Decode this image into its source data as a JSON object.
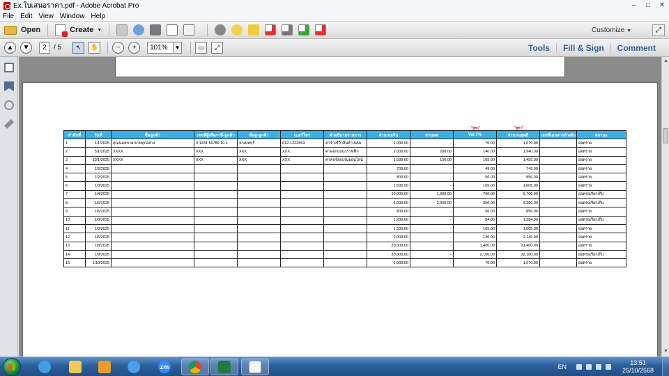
{
  "window": {
    "title": "Ex.ใบเสนอราคา.pdf - Adobe Acrobat Pro",
    "controls": [
      "–",
      "□",
      "✕"
    ]
  },
  "menu": [
    "File",
    "Edit",
    "View",
    "Window",
    "Help"
  ],
  "toolbar": {
    "open_label": "Open",
    "create_label": "Create",
    "create_arrow": "▼",
    "customize_label": "Customize",
    "customize_arrow": "▼",
    "expand_symbol": "⤢"
  },
  "nav": {
    "current_page": "2",
    "total_pages": "/ 5",
    "zoom": "101%",
    "zoom_arrow": "▼",
    "prev_symbol": "▲",
    "next_symbol": "▼",
    "zoom_out_symbol": "−",
    "zoom_in_symbol": "+",
    "links": [
      "Tools",
      "Fill & Sign",
      "Comment"
    ]
  },
  "document": {
    "notes": [
      "*สูตร*",
      "*สูตร*"
    ],
    "headers": [
      "ลำดับที่",
      "วันที่",
      "ชื่อลูกค้า",
      "เลขที่ผู้เสียภาษี-ลูกค้า",
      "ที่อยู่-ลูกค้า",
      "เบอร์โทร",
      "คำอธิบายรายการ",
      "จำนวนเงิน",
      "ส่วนลด",
      "Vat 7%",
      "จำนวนสุทธิ",
      "เลขที่เอกสารอ้างอิง",
      "สถานะ"
    ],
    "rows": [
      [
        "1",
        "1/1/2025",
        "คุณนอลขาย  ขายทุกอย่าง",
        "0 1234 56789 10 1",
        "จ.นนทบุรี",
        "012-1222553",
        "ค่าจ้างรีวิวสินค้า AAA",
        "1,000.00",
        "-",
        "70.00",
        "1,070.00",
        "",
        "ออตราย"
      ],
      [
        "2",
        "5/1/2025",
        "XXXX",
        "XXX",
        "XXX",
        "XXX",
        "ค่าออกแบบกราฟฟิก",
        "2,000.00",
        "200.00",
        "140.00",
        "1,940.00",
        "",
        "ออตราย"
      ],
      [
        "3",
        "10/1/2025",
        "XXXX",
        "XXX",
        "XXX",
        "XXX",
        "ค่าคอร์สอบรมออนไลน์",
        "1,500.00",
        "150.00",
        "105.00",
        "1,455.00",
        "",
        "ออตราย"
      ],
      [
        "4",
        "1/2/2025",
        "",
        "",
        "",
        "",
        "",
        "700.00",
        "-",
        "49.00",
        "749.00",
        "",
        "ออตราย"
      ],
      [
        "5",
        "1/2/2025",
        "",
        "",
        "",
        "",
        "",
        "800.00",
        "-",
        "56.00",
        "856.00",
        "",
        "ออตราย"
      ],
      [
        "6",
        "1/3/2025",
        "",
        "",
        "",
        "",
        "",
        "1,500.00",
        "-",
        "105.00",
        "1,605.00",
        "",
        "ออตราย"
      ],
      [
        "7",
        "1/4/2025",
        "",
        "",
        "",
        "",
        "",
        "10,000.00",
        "1,000.00",
        "700.00",
        "9,700.00",
        "",
        "ออตรอเรียกเก็บ"
      ],
      [
        "8",
        "1/5/2025",
        "",
        "",
        "",
        "",
        "",
        "5,000.00",
        "2,000.00",
        "350.00",
        "3,350.00",
        "",
        "ออตรอเรียกเก็บ"
      ],
      [
        "9",
        "1/6/2025",
        "",
        "",
        "",
        "",
        "",
        "800.00",
        "-",
        "56.00",
        "856.00",
        "",
        "ออตราย"
      ],
      [
        "10",
        "1/8/2025",
        "",
        "",
        "",
        "",
        "",
        "1,200.00",
        "-",
        "84.00",
        "1,284.00",
        "",
        "ออตรอเรียกเก็บ"
      ],
      [
        "11",
        "1/9/2025",
        "",
        "",
        "",
        "",
        "",
        "1,500.00",
        "-",
        "105.00",
        "1,605.00",
        "",
        "ออตราย"
      ],
      [
        "12",
        "1/6/2025",
        "",
        "",
        "",
        "",
        "",
        "2,000.00",
        "-",
        "140.00",
        "2,140.00",
        "",
        "ออตราย"
      ],
      [
        "13",
        "1/8/2025",
        "",
        "",
        "",
        "",
        "",
        "20,000.00",
        "-",
        "1,400.00",
        "21,400.00",
        "",
        "ออตราย"
      ],
      [
        "14",
        "1/9/2025",
        "",
        "",
        "",
        "",
        "",
        "30,000.00",
        "-",
        "2,100.00",
        "32,100.00",
        "",
        "ออตรอเรียกเก็บ"
      ],
      [
        "15",
        "1/10/2025",
        "",
        "",
        "",
        "",
        "",
        "1,000.00",
        "-",
        "70.00",
        "1,070.00",
        "",
        "ออตราย"
      ]
    ]
  },
  "taskbar": {
    "zoom_label": "zm",
    "language": "EN",
    "time": "13:51",
    "date": "25/10/2568"
  },
  "colors": {
    "header_bg": "#3bb0e4",
    "note_red": "#d41e1e",
    "link_blue": "#2f5f8f"
  }
}
